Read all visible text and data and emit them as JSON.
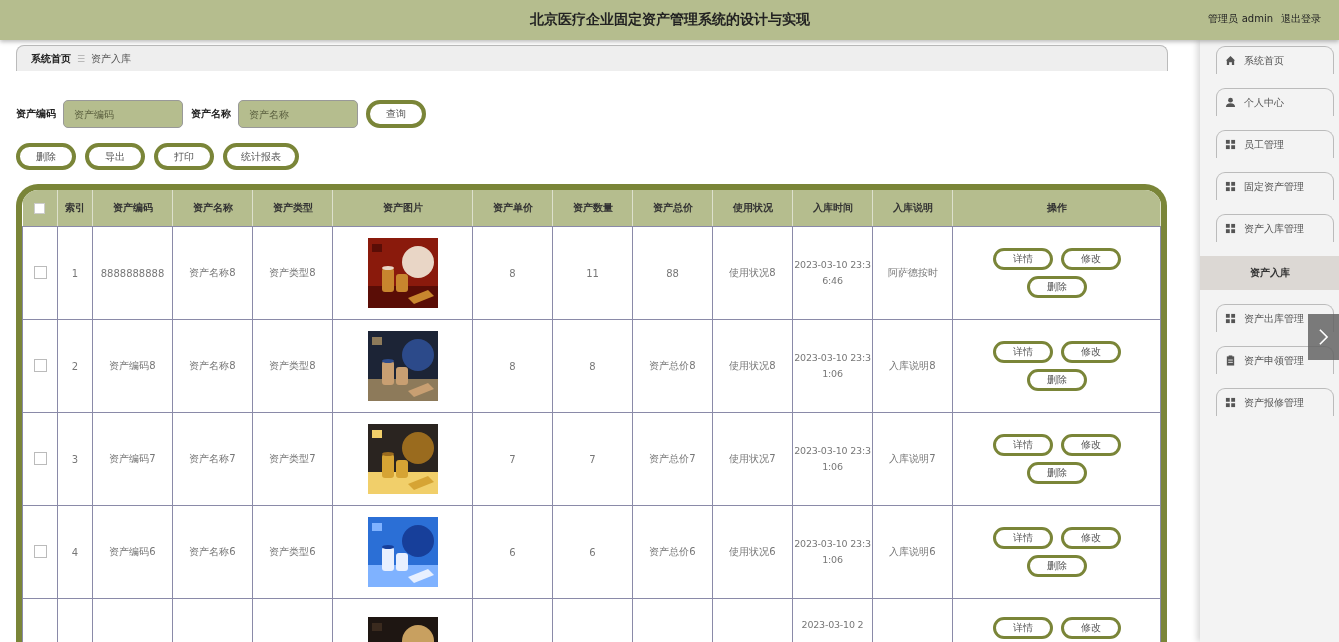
{
  "header": {
    "title": "北京医疗企业固定资产管理系统的设计与实现",
    "user": "管理员 admin",
    "logout": "退出登录"
  },
  "breadcrumb": {
    "home": "系统首页",
    "separator": "☰",
    "current": "资产入库"
  },
  "search": [
    {
      "label": "资产编码",
      "placeholder": "资产编码"
    },
    {
      "label": "资产名称",
      "placeholder": "资产名称"
    }
  ],
  "query_button": "查询",
  "actions": [
    "删除",
    "导出",
    "打印",
    "统计报表"
  ],
  "table": {
    "all_checked": false,
    "columns": [
      "索引",
      "资产编码",
      "资产名称",
      "资产类型",
      "资产图片",
      "资产单价",
      "资产数量",
      "资产总价",
      "使用状况",
      "入库时间",
      "入库说明",
      "操作"
    ],
    "rows": [
      {
        "checked": false,
        "cells": [
          "1",
          "8888888888",
          "资产名称8",
          "资产类型8",
          null,
          "8",
          "11",
          "88",
          "使用状况8",
          "2023-03-10 23:36:46",
          "阿萨德按时"
        ],
        "buttons": [
          "详情",
          "修改",
          "删除"
        ]
      },
      {
        "checked": false,
        "cells": [
          "2",
          "资产编码8",
          "资产名称8",
          "资产类型8",
          null,
          "8",
          "8",
          "资产总价8",
          "使用状况8",
          "2023-03-10 23:31:06",
          "入库说明8"
        ],
        "buttons": [
          "详情",
          "修改",
          "删除"
        ]
      },
      {
        "checked": false,
        "cells": [
          "3",
          "资产编码7",
          "资产名称7",
          "资产类型7",
          null,
          "7",
          "7",
          "资产总价7",
          "使用状况7",
          "2023-03-10 23:31:06",
          "入库说明7"
        ],
        "buttons": [
          "详情",
          "修改",
          "删除"
        ]
      },
      {
        "checked": false,
        "cells": [
          "4",
          "资产编码6",
          "资产名称6",
          "资产类型6",
          null,
          "6",
          "6",
          "资产总价6",
          "使用状况6",
          "2023-03-10 23:31:06",
          "入库说明6"
        ],
        "buttons": [
          "详情",
          "修改",
          "删除"
        ]
      },
      {
        "cells": [
          null,
          null,
          null,
          null,
          null,
          null,
          null,
          null,
          null,
          "2023-03-10 2",
          null
        ],
        "buttons": [
          "详情",
          "修改"
        ]
      }
    ]
  },
  "sidebar": {
    "items": [
      {
        "label": "系统首页",
        "kind": "home",
        "selected": false
      },
      {
        "label": "个人中心",
        "kind": "person",
        "selected": false
      },
      {
        "label": "员工管理",
        "kind": "grid",
        "selected": false
      },
      {
        "label": "固定资产管理",
        "kind": "grid",
        "selected": false
      },
      {
        "label": "资产入库管理",
        "kind": "grid",
        "selected": false
      },
      {
        "label": "资产入库",
        "kind": "sub",
        "selected": true
      },
      {
        "label": "资产出库管理",
        "kind": "grid",
        "selected": false
      },
      {
        "label": "资产申领管理",
        "kind": "clipboard",
        "selected": false
      },
      {
        "label": "资产报修管理",
        "kind": "grid",
        "selected": false
      }
    ]
  }
}
